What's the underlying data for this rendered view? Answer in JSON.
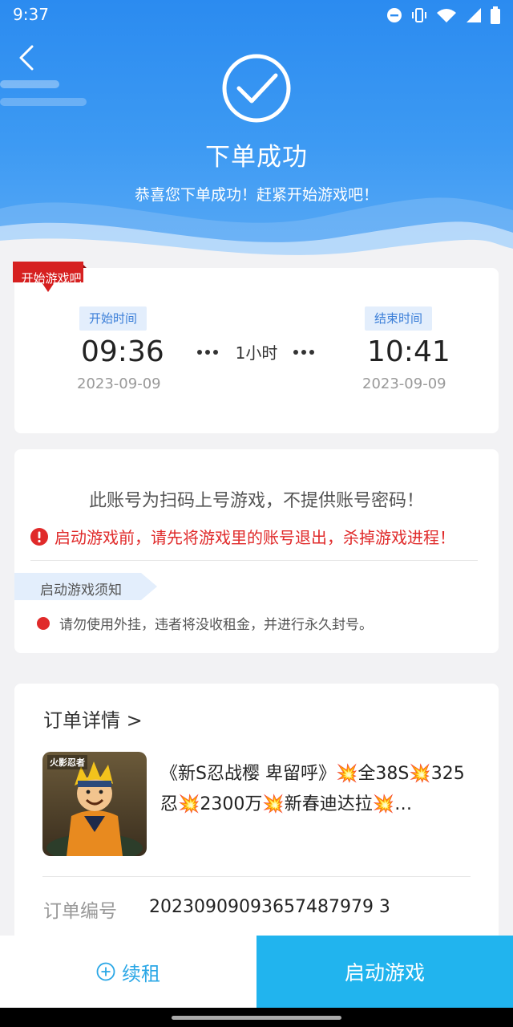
{
  "status_bar": {
    "time": "9:37"
  },
  "header": {
    "title": "下单成功",
    "subtitle": "恭喜您下单成功！赶紧开始游戏吧！"
  },
  "time_card": {
    "ribbon": "开始游戏吧",
    "start_label": "开始时间",
    "start_time": "09:36",
    "start_date": "2023-09-09",
    "duration": "1小时",
    "end_label": "结束时间",
    "end_time": "10:41",
    "end_date": "2023-09-09"
  },
  "notice_card": {
    "main": "此账号为扫码上号游戏，不提供账号密码！",
    "warning": "启动游戏前，请先将游戏里的账号退出，杀掉游戏进程！",
    "tips_title": "启动游戏须知",
    "rules": [
      "请勿使用外挂，违者将没收租金，并进行永久封号。"
    ]
  },
  "order_card": {
    "title": "订单详情 >",
    "thumbnail_text": "火影忍者",
    "product_title": "《新S忍战樱 卑留呼》💥全38S💥325忍💥2300万💥新春迪达拉💥…",
    "order_no_label": "订单编号",
    "order_no": "20230909093657487979 3"
  },
  "bottom_bar": {
    "renew_label": "续租",
    "launch_label": "启动游戏"
  },
  "colors": {
    "header_blue": "#2b8bf0",
    "launch_button": "#21b4ee",
    "warning_red": "#e02a2a",
    "tag_text": "#3a7ed8"
  }
}
